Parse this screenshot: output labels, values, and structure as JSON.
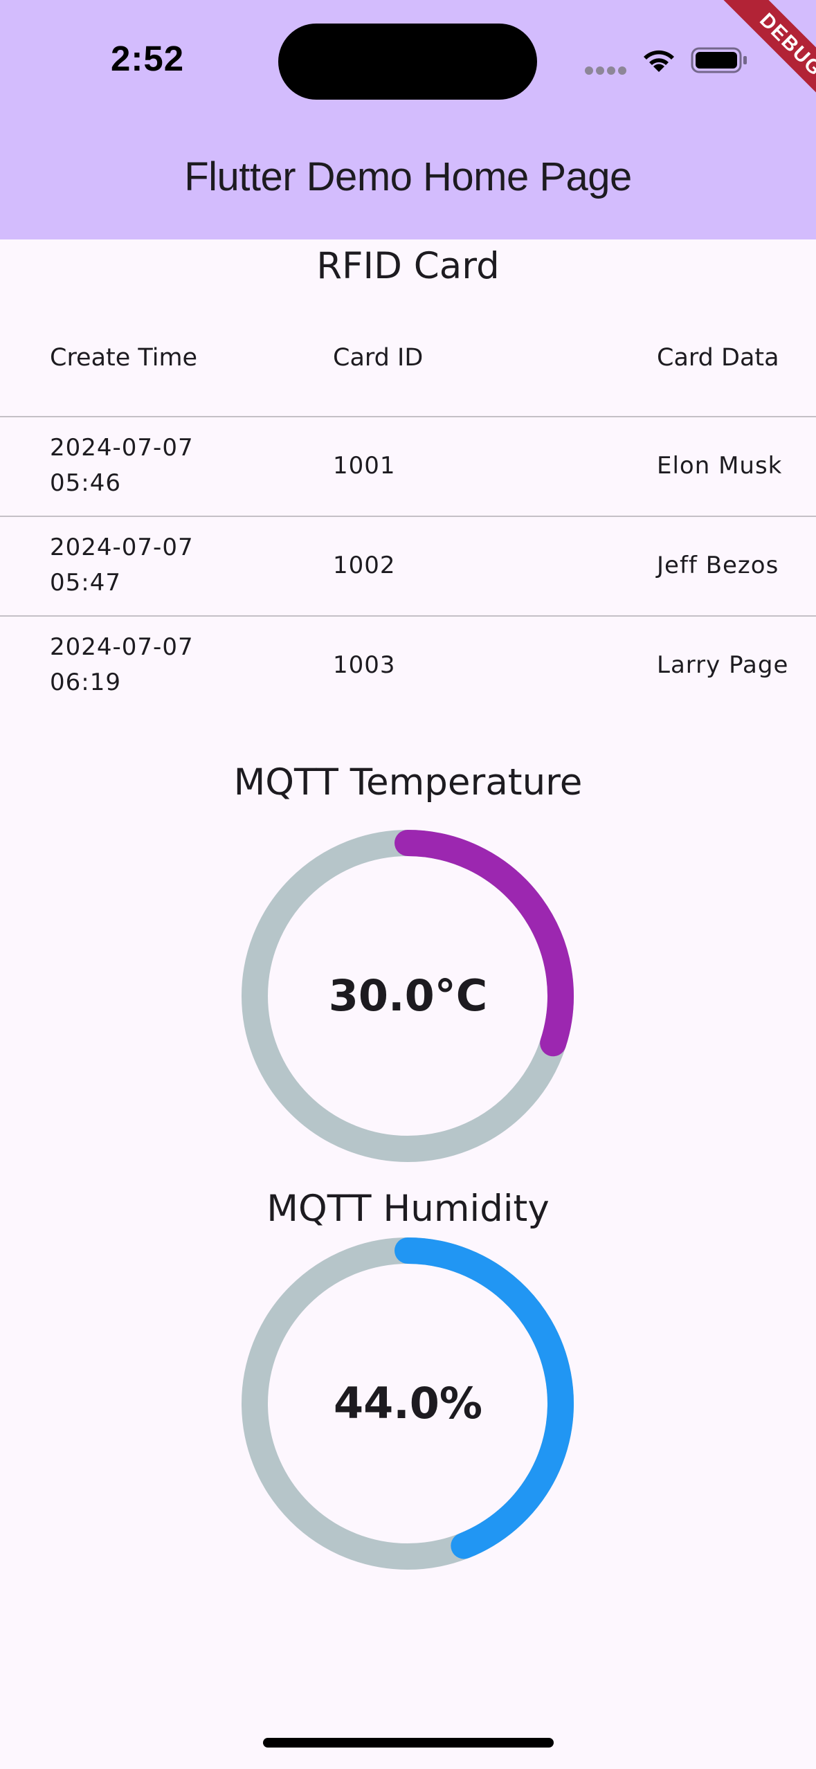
{
  "status_bar": {
    "time": "2:52"
  },
  "debug_banner": "DEBUG",
  "app_bar": {
    "title": "Flutter Demo Home Page"
  },
  "rfid": {
    "title": "RFID Card",
    "columns": [
      "Create Time",
      "Card ID",
      "Card Data"
    ],
    "rows": [
      {
        "time_date": "2024-07-07",
        "time_clock": "05:46",
        "card_id": "1001",
        "card_data": "Elon Musk"
      },
      {
        "time_date": "2024-07-07",
        "time_clock": "05:47",
        "card_id": "1002",
        "card_data": "Jeff Bezos"
      },
      {
        "time_date": "2024-07-07",
        "time_clock": "06:19",
        "card_id": "1003",
        "card_data": "Larry Page"
      }
    ]
  },
  "temperature": {
    "title": "MQTT Temperature",
    "value_text": "30.0°C",
    "progress": 0.3,
    "color": "#9c27b0",
    "track_color": "#b6c5c9"
  },
  "humidity": {
    "title": "MQTT Humidity",
    "value_text": "44.0%",
    "progress": 0.44,
    "color": "#2196f3",
    "track_color": "#b6c5c9"
  },
  "icons": {
    "wifi": "wifi-icon",
    "battery": "battery-icon",
    "signal": "cellular-signal-icon"
  }
}
